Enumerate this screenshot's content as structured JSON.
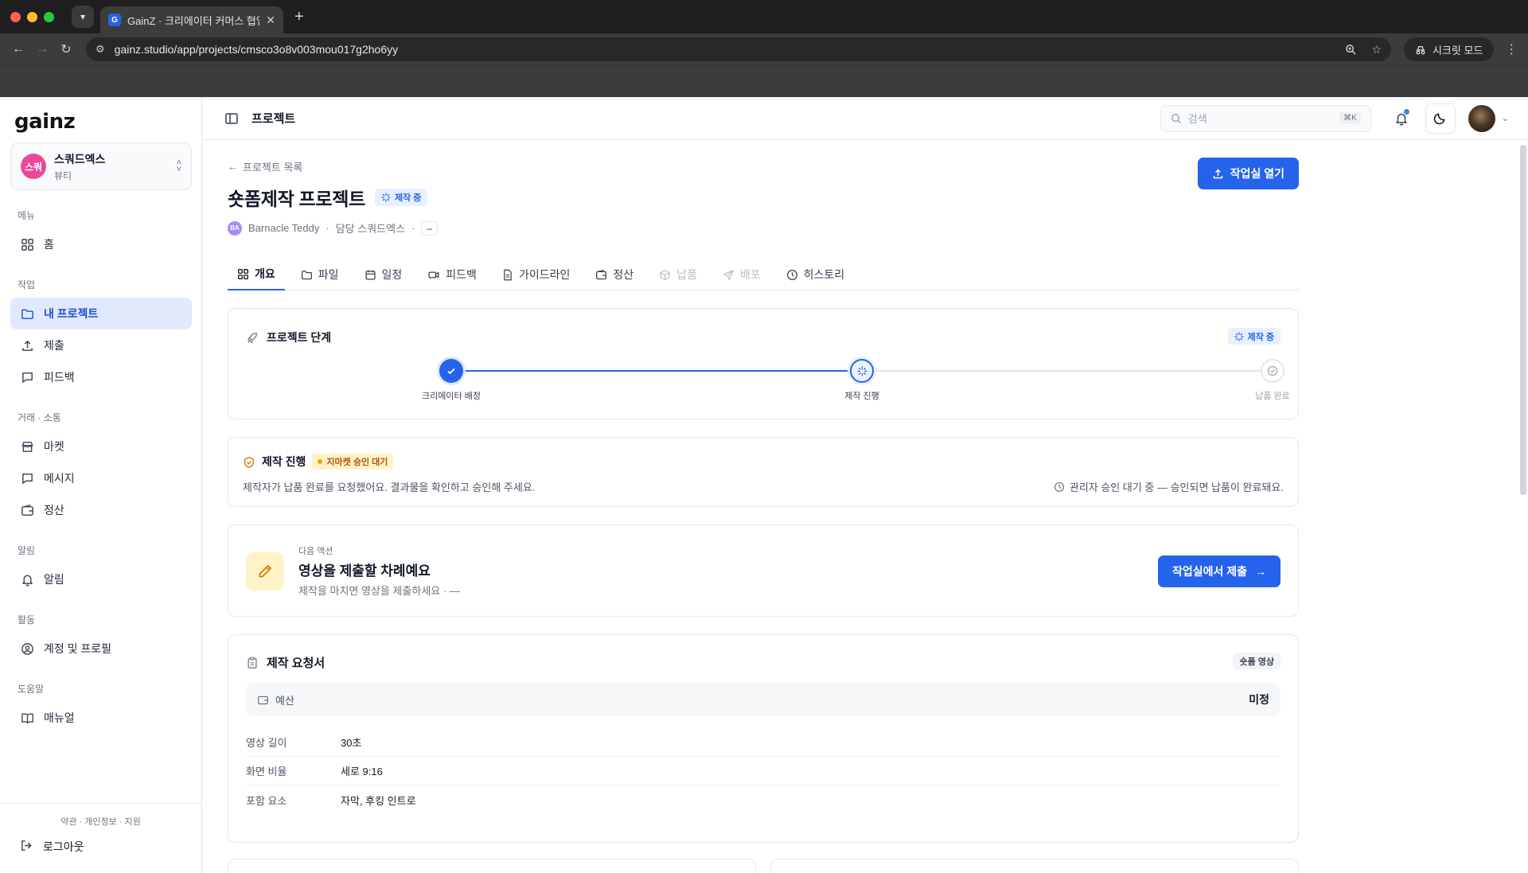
{
  "browser": {
    "tab_title": "GainZ · 크리에이터 커머스 협업 C",
    "favicon_letter": "G",
    "url": "gainz.studio/app/projects/cmsco3o8v003mou017g2ho6yy",
    "incognito_label": "시크릿 모드"
  },
  "sidebar": {
    "logo": "gainz",
    "workspace": {
      "avatar": "스쿼",
      "name": "스쿼드엑스",
      "category": "뷰티"
    },
    "groups": [
      {
        "label": "메뉴",
        "items": [
          {
            "label": "홈",
            "icon": "grid-icon"
          }
        ]
      },
      {
        "label": "작업",
        "items": [
          {
            "label": "내 프로젝트",
            "icon": "folder-icon"
          },
          {
            "label": "제출",
            "icon": "upload-icon"
          },
          {
            "label": "피드백",
            "icon": "message-icon"
          }
        ]
      },
      {
        "label": "거래 · 소통",
        "items": [
          {
            "label": "마켓",
            "icon": "store-icon"
          },
          {
            "label": "메시지",
            "icon": "message-icon"
          },
          {
            "label": "정산",
            "icon": "wallet-icon"
          }
        ]
      },
      {
        "label": "알림",
        "items": [
          {
            "label": "알림",
            "icon": "bell-icon"
          }
        ]
      },
      {
        "label": "활동",
        "items": [
          {
            "label": "계정 및 프로필",
            "icon": "user-circle-icon"
          }
        ]
      },
      {
        "label": "도움말",
        "items": [
          {
            "label": "매뉴얼",
            "icon": "book-icon"
          }
        ]
      }
    ],
    "footer_links": "약관 · 개인정보 · 지원",
    "logout": "로그아웃"
  },
  "topbar": {
    "page_label": "프로젝트",
    "search_placeholder": "검색",
    "search_shortcut": "⌘K"
  },
  "project": {
    "back_label": "프로젝트 목록",
    "title": "숏폼제작 프로젝트",
    "status": "제작 중",
    "open_studio_label": "작업실 열기",
    "creator_initials": "BA",
    "creator": "Barnacle Teddy",
    "manager": "담당 스쿼드엑스",
    "extra": "–"
  },
  "tabs": [
    {
      "label": "개요",
      "icon": "grid-icon",
      "state": "active"
    },
    {
      "label": "파일",
      "icon": "folder-icon",
      "state": "normal"
    },
    {
      "label": "일정",
      "icon": "calendar-icon",
      "state": "normal"
    },
    {
      "label": "피드백",
      "icon": "video-icon",
      "state": "normal"
    },
    {
      "label": "가이드라인",
      "icon": "document-icon",
      "state": "normal"
    },
    {
      "label": "정산",
      "icon": "wallet-icon",
      "state": "normal"
    },
    {
      "label": "납품",
      "icon": "package-icon",
      "state": "disabled"
    },
    {
      "label": "배포",
      "icon": "send-icon",
      "state": "disabled"
    },
    {
      "label": "히스토리",
      "icon": "clock-icon",
      "state": "normal"
    }
  ],
  "stage": {
    "title": "프로젝트 단계",
    "badge": "제작 중",
    "steps": [
      {
        "label": "크리에이터 배정",
        "state": "done"
      },
      {
        "label": "제작 진행",
        "state": "current"
      },
      {
        "label": "납품 완료",
        "state": "todo"
      }
    ]
  },
  "progress": {
    "title": "제작 진행",
    "badge": "지마켓 승인 대기",
    "description": "제작자가 납품 완료를 요청했어요. 결과물을 확인하고 승인해 주세요.",
    "note": "관리자 승인 대기 중 — 승인되면 납품이 완료돼요."
  },
  "next_action": {
    "kicker": "다음 액션",
    "title": "영상을 제출할 차례예요",
    "subtitle": "제작을 마치면 영상을 제출하세요 · —",
    "button": "작업실에서 제출"
  },
  "brief": {
    "title": "제작 요청서",
    "tag": "숏폼 영상",
    "budget_label": "예산",
    "budget_value": "미정",
    "specs": [
      {
        "key": "영상 길이",
        "value": "30초"
      },
      {
        "key": "화면 비율",
        "value": "세로 9:16"
      },
      {
        "key": "포함 요소",
        "value": "자막, 후킹 인트로"
      }
    ]
  },
  "colors": {
    "accent": "#2563eb",
    "warning": "#f59e0b",
    "workspace_avatar": "#ec4899"
  }
}
